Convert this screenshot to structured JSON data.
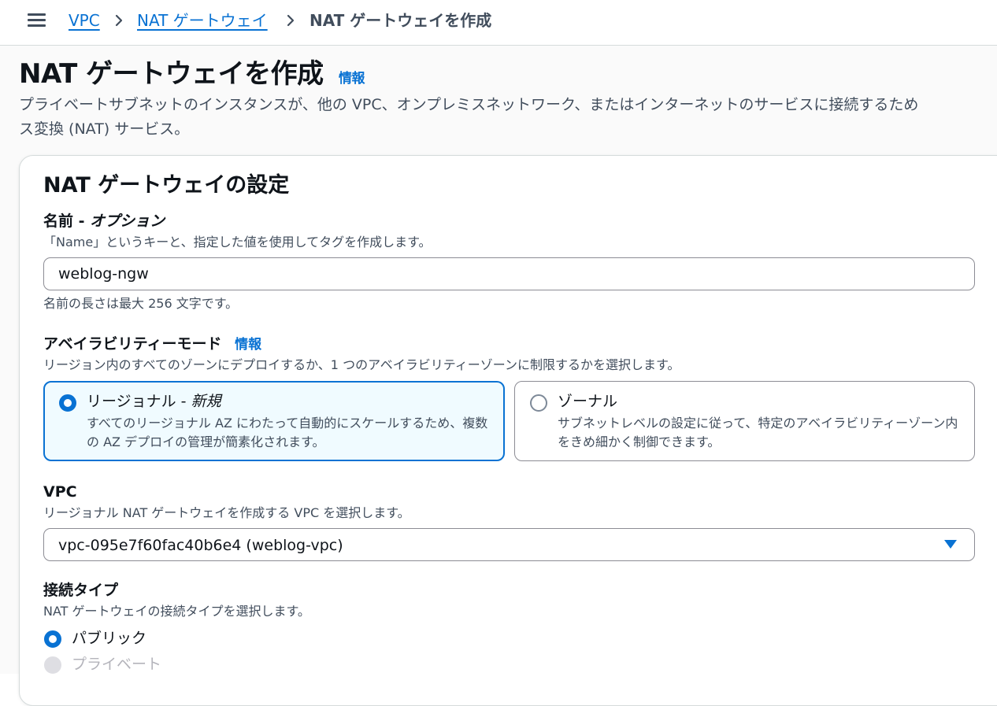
{
  "breadcrumb": {
    "items": [
      {
        "label": "VPC"
      },
      {
        "label": "NAT ゲートウェイ"
      }
    ],
    "current": "NAT ゲートウェイを作成"
  },
  "header": {
    "title": "NAT ゲートウェイを作成",
    "info": "情報",
    "description_line1": "プライベートサブネットのインスタンスが、他の VPC、オンプレミスネットワーク、またはインターネットのサービスに接続するため",
    "description_line2": "ス変換 (NAT) サービス。"
  },
  "settings": {
    "title": "NAT ゲートウェイの設定",
    "name": {
      "label_main": "名前 - ",
      "label_optional": "オプション",
      "description": "「Name」というキーと、指定した値を使用してタグを作成します。",
      "value": "weblog-ngw",
      "constraint": "名前の長さは最大 256 文字です。"
    },
    "availability": {
      "label": "アベイラビリティーモード",
      "info": "情報",
      "description": "リージョン内のすべてのゾーンにデプロイするか、1 つのアベイラビリティーゾーンに制限するかを選択します。",
      "options": [
        {
          "title_main": "リージョナル - ",
          "title_tag": "新規",
          "description": "すべてのリージョナル AZ にわたって自動的にスケールするため、複数の AZ デプロイの管理が簡素化されます。",
          "selected": true
        },
        {
          "title_main": "ゾーナル",
          "title_tag": "",
          "description": "サブネットレベルの設定に従って、特定のアベイラビリティーゾーン内をきめ細かく制御できます。",
          "selected": false
        }
      ]
    },
    "vpc": {
      "label": "VPC",
      "description": "リージョナル NAT ゲートウェイを作成する VPC を選択します。",
      "selected_value": "vpc-095e7f60fac40b6e4 (weblog-vpc)"
    },
    "connectivity": {
      "label": "接続タイプ",
      "description": "NAT ゲートウェイの接続タイプを選択します。",
      "options": [
        {
          "label": "パブリック",
          "selected": true,
          "disabled": false
        },
        {
          "label": "プライベート",
          "selected": false,
          "disabled": true
        }
      ]
    }
  },
  "colors": {
    "accent": "#0972d3",
    "selected_tile_bg": "#f0fbff",
    "text": "#0f141a",
    "secondary_text": "#414d5c"
  }
}
